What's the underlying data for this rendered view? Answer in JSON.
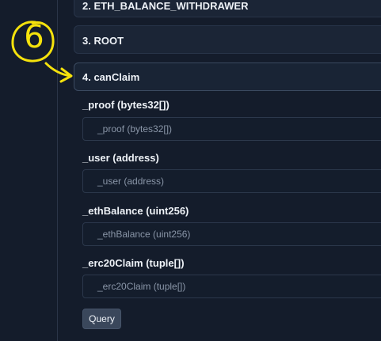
{
  "functions": [
    {
      "label": "2. ETH_BALANCE_WITHDRAWER",
      "state": "collapsed"
    },
    {
      "label": "3. ROOT",
      "state": "collapsed"
    },
    {
      "label": "4. canClaim",
      "state": "expanded"
    }
  ],
  "params": [
    {
      "label": "_proof (bytes32[])",
      "placeholder": "_proof (bytes32[])"
    },
    {
      "label": "_user (address)",
      "placeholder": "_user (address)"
    },
    {
      "label": "_ethBalance (uint256)",
      "placeholder": "_ethBalance (uint256)"
    },
    {
      "label": "_erc20Claim (tuple[])",
      "placeholder": "_erc20Claim (tuple[])"
    }
  ],
  "query_label": "Query",
  "annotation": {
    "step": "6",
    "color": "#f5e20c",
    "icons": [
      "circle",
      "arrow-right"
    ]
  },
  "colors": {
    "background": "#141c2b",
    "card": "#1b2536",
    "accent": "#f5e20c"
  }
}
